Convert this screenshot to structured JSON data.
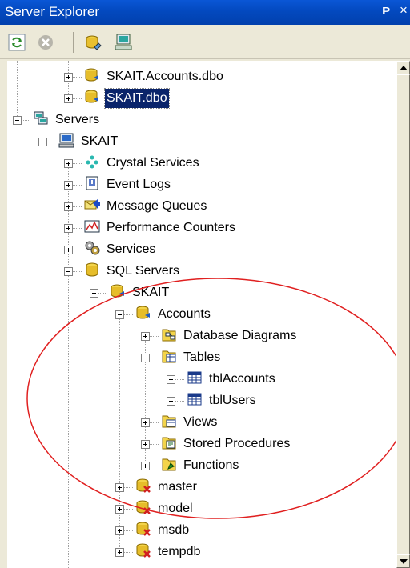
{
  "window": {
    "title": "Server Explorer",
    "pin_glyph": "ᴘ",
    "close_glyph": "×"
  },
  "toolbar": {
    "buttons": [
      "refresh-icon",
      "stop-icon",
      "connect-to-database-icon",
      "connect-to-server-icon"
    ]
  },
  "tree": {
    "items": [
      {
        "label": "SKAIT.Accounts.dbo",
        "icon": "database-connection-icon",
        "level": 2,
        "toggle": "plus"
      },
      {
        "label": "SKAIT.dbo",
        "icon": "database-connection-icon",
        "level": 2,
        "toggle": "plus",
        "selected": true
      },
      {
        "label": "Servers",
        "icon": "servers-icon",
        "level": 0,
        "toggle": "minus"
      },
      {
        "label": "SKAIT",
        "icon": "computer-icon",
        "level": 1,
        "toggle": "minus"
      },
      {
        "label": "Crystal Services",
        "icon": "crystal-services-icon",
        "level": 2,
        "toggle": "plus"
      },
      {
        "label": "Event Logs",
        "icon": "event-logs-icon",
        "level": 2,
        "toggle": "plus"
      },
      {
        "label": "Message Queues",
        "icon": "message-queues-icon",
        "level": 2,
        "toggle": "plus"
      },
      {
        "label": "Performance Counters",
        "icon": "performance-counters-icon",
        "level": 2,
        "toggle": "plus"
      },
      {
        "label": "Services",
        "icon": "services-icon",
        "level": 2,
        "toggle": "plus"
      },
      {
        "label": "SQL Servers",
        "icon": "sql-servers-icon",
        "level": 2,
        "toggle": "minus"
      },
      {
        "label": "SKAIT",
        "icon": "sql-server-instance-icon",
        "level": 3,
        "toggle": "minus"
      },
      {
        "label": "Accounts",
        "icon": "database-icon",
        "level": 4,
        "toggle": "minus"
      },
      {
        "label": "Database Diagrams",
        "icon": "database-diagrams-icon",
        "level": 5,
        "toggle": "plus"
      },
      {
        "label": "Tables",
        "icon": "tables-folder-icon",
        "level": 5,
        "toggle": "minus"
      },
      {
        "label": "tblAccounts",
        "icon": "table-icon",
        "level": 6,
        "toggle": "plus"
      },
      {
        "label": "tblUsers",
        "icon": "table-icon",
        "level": 6,
        "toggle": "plus"
      },
      {
        "label": "Views",
        "icon": "views-folder-icon",
        "level": 5,
        "toggle": "plus"
      },
      {
        "label": "Stored Procedures",
        "icon": "stored-procedures-icon",
        "level": 5,
        "toggle": "plus"
      },
      {
        "label": "Functions",
        "icon": "functions-icon",
        "level": 5,
        "toggle": "plus"
      },
      {
        "label": "master",
        "icon": "database-unavailable-icon",
        "level": 4,
        "toggle": "plus"
      },
      {
        "label": "model",
        "icon": "database-unavailable-icon",
        "level": 4,
        "toggle": "plus"
      },
      {
        "label": "msdb",
        "icon": "database-unavailable-icon",
        "level": 4,
        "toggle": "plus"
      },
      {
        "label": "tempdb",
        "icon": "database-unavailable-icon",
        "level": 4,
        "toggle": "plus"
      }
    ]
  },
  "annotation": {
    "shape": "ellipse",
    "color": "#e02020"
  },
  "colors": {
    "titlebar": "#0349bf",
    "selection": "#0a246a",
    "highlight_ellipse": "#e02020"
  }
}
